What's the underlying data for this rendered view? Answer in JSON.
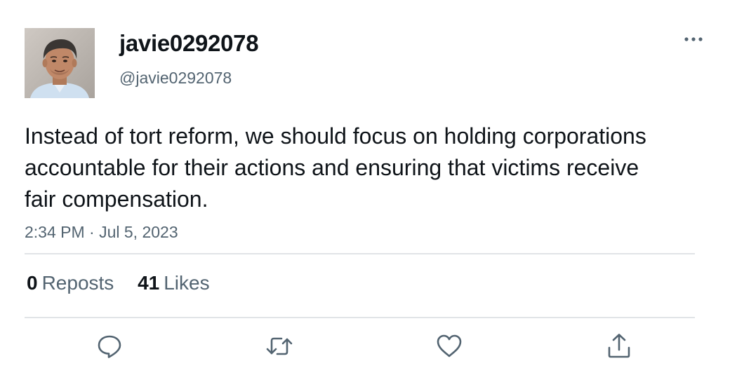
{
  "tweet": {
    "display_name": "javie0292078",
    "handle": "@javie0292078",
    "text": "Instead of tort reform, we should focus on holding corporations accountable for their actions and ensuring that victims receive fair compensation.",
    "timestamp": "2:34 PM · Jul 5, 2023",
    "stats": {
      "reposts_count": "0",
      "reposts_label": "Reposts",
      "likes_count": "41",
      "likes_label": "Likes"
    }
  },
  "icons": {
    "more": "more-horizontal-icon",
    "reply": "reply-icon",
    "repost": "repost-icon",
    "like": "heart-icon",
    "share": "share-icon"
  },
  "colors": {
    "text_primary": "#0f1419",
    "text_secondary": "#536471",
    "divider": "#e1e4e7"
  }
}
